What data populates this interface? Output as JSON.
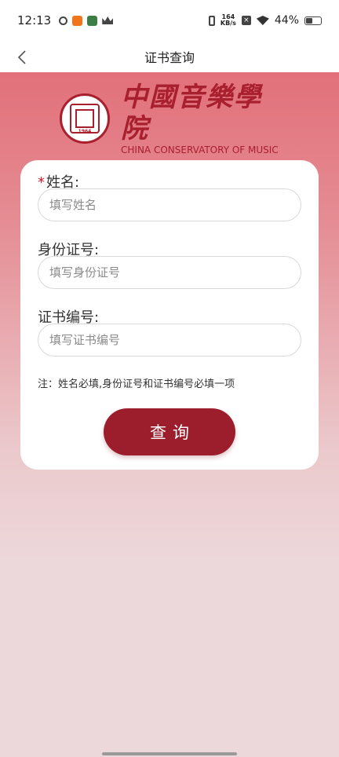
{
  "status_bar": {
    "time": "12:13",
    "net_speed_value": "164",
    "net_speed_unit": "KB/s",
    "battery": "44%"
  },
  "nav": {
    "title": "证书查询"
  },
  "logo": {
    "seal_year": "1964",
    "cn_name": "中國音樂學院",
    "en_name": "CHINA CONSERVATORY OF MUSIC"
  },
  "form": {
    "required_mark": "*",
    "name": {
      "label": "姓名:",
      "placeholder": "填写姓名",
      "value": ""
    },
    "id_number": {
      "label": "身份证号:",
      "placeholder": "填写身份证号",
      "value": ""
    },
    "cert_number": {
      "label": "证书编号:",
      "placeholder": "填写证书编号",
      "value": ""
    },
    "note": "注：姓名必填,身份证号和证书编号必填一项",
    "submit_label": "查询"
  },
  "colors": {
    "brand_red": "#9c1e2c",
    "header_pink": "#e2707a",
    "background": "#ecd8da"
  }
}
